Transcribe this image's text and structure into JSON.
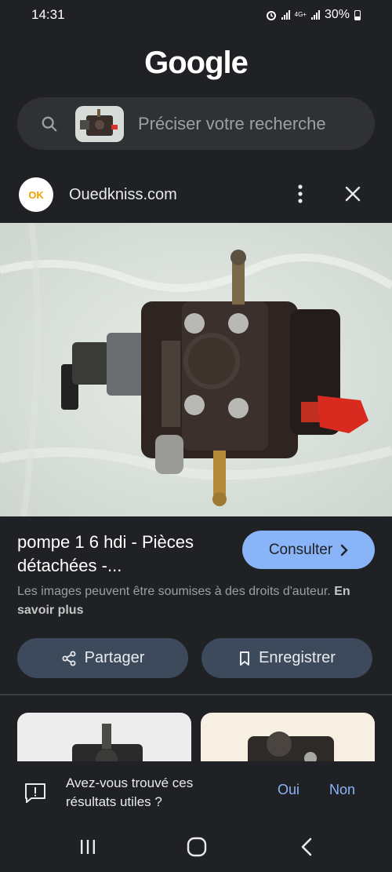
{
  "status": {
    "time": "14:31",
    "network": "4G+",
    "battery": "30%"
  },
  "header": {
    "logo": "Google"
  },
  "search": {
    "placeholder": "Préciser votre recherche"
  },
  "result": {
    "source": "Ouedkniss.com",
    "source_logo": "OK",
    "title_line1": "pompe 1 6 hdi - Pièces",
    "title_line2": "détachées -...",
    "consult_label": "Consulter",
    "copyright_text": "Les images peuvent être soumises à des droits d'auteur.",
    "learn_more": "En savoir plus",
    "share_label": "Partager",
    "save_label": "Enregistrer"
  },
  "feedback": {
    "line1": "Avez-vous trouvé ces",
    "line2": "résultats utiles ?",
    "yes": "Oui",
    "no": "Non"
  },
  "colors": {
    "background": "#202124",
    "accent": "#8ab4f8",
    "button_bg": "#3c4a5c"
  },
  "icons": [
    "alarm-icon",
    "signal-icon",
    "battery-icon",
    "search-icon",
    "more-vert-icon",
    "close-icon",
    "chevron-right-icon",
    "share-icon",
    "bookmark-icon",
    "feedback-icon",
    "recents-icon",
    "home-icon",
    "back-icon"
  ]
}
